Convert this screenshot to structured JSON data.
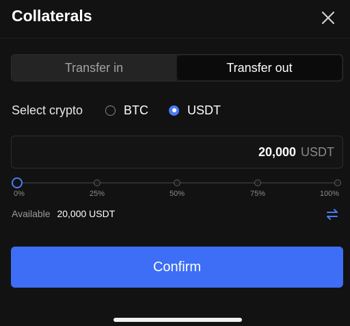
{
  "header": {
    "title": "Collaterals",
    "close_icon": "close-icon"
  },
  "tabs": [
    {
      "label": "Transfer in",
      "active": false
    },
    {
      "label": "Transfer out",
      "active": true
    }
  ],
  "crypto_select": {
    "label": "Select crypto",
    "options": [
      {
        "label": "BTC",
        "selected": false
      },
      {
        "label": "USDT",
        "selected": true
      }
    ]
  },
  "amount": {
    "value": "20,000",
    "unit": "USDT"
  },
  "slider": {
    "value_percent": 0,
    "ticks": [
      "0%",
      "25%",
      "50%",
      "75%",
      "100%"
    ]
  },
  "available": {
    "label": "Available",
    "value": "20,000 USDT",
    "swap_icon": "swap-icon"
  },
  "confirm": {
    "label": "Confirm"
  },
  "colors": {
    "accent": "#3d6ef5",
    "background": "#121212"
  }
}
